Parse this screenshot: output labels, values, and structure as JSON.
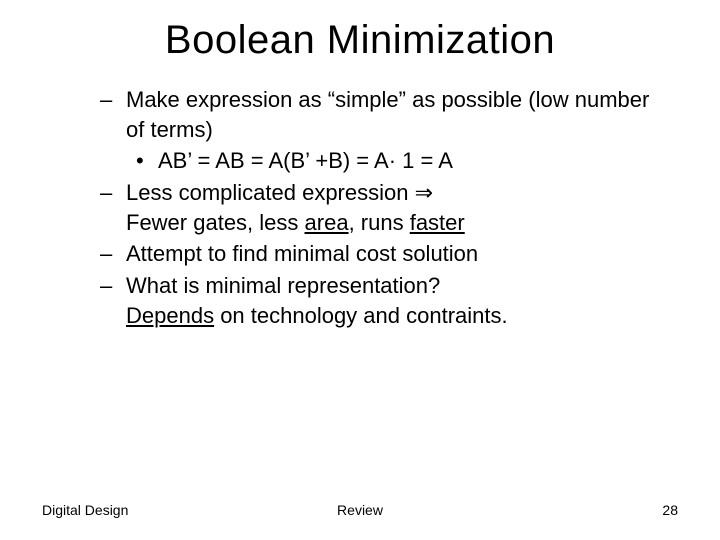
{
  "title": "Boolean Minimization",
  "items": [
    {
      "text_a": "Make expression as “simple” as possible (low number of terms)",
      "sub": "AB’ = AB = A(B’ +B) = A· 1 = A"
    },
    {
      "text_a": "Less complicated expression ",
      "text_b": "Fewer gates, less ",
      "u1": "area",
      "text_c": ", runs ",
      "u2": "faster"
    },
    {
      "text_a": "Attempt to find minimal cost solution"
    },
    {
      "text_a": "What is minimal representation? ",
      "u1": "Depends",
      "text_b": " on technology and contraints."
    }
  ],
  "footer": {
    "left": "Digital Design",
    "center": "Review",
    "right": "28"
  }
}
